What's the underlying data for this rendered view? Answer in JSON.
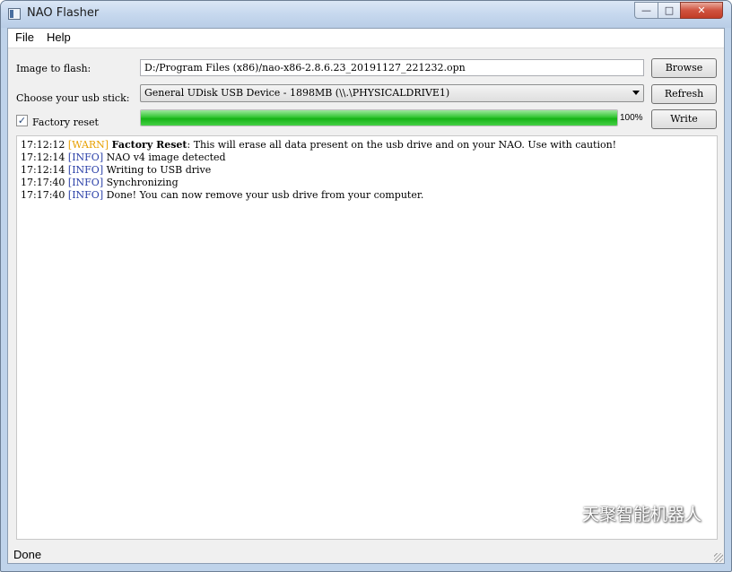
{
  "window": {
    "title": "NAO Flasher"
  },
  "menu": [
    "File",
    "Help"
  ],
  "form": {
    "image_label": "Image to flash:",
    "image_path": "D:/Program Files (x86)/nao-x86-2.8.6.23_20191127_221232.opn",
    "usb_label": "Choose your usb stick:",
    "usb_device": "General UDisk USB Device - 1898MB (\\\\.\\PHYSICALDRIVE1)",
    "factory_reset_label": "Factory reset",
    "factory_reset_checked": true,
    "progress_percent": 100,
    "progress_text": "100%",
    "browse_label": "Browse",
    "refresh_label": "Refresh",
    "write_label": "Write"
  },
  "log": [
    {
      "time": "17:12:12",
      "level": "[WARN]",
      "kind": "warn",
      "bold": "Factory Reset",
      "message": ": This will erase all data present on the usb drive and on your NAO. Use with caution!"
    },
    {
      "time": "17:12:14",
      "level": "[INFO]",
      "kind": "info",
      "bold": "",
      "message": "NAO v4 image detected"
    },
    {
      "time": "17:12:14",
      "level": "[INFO]",
      "kind": "info",
      "bold": "",
      "message": "Writing to USB drive"
    },
    {
      "time": "17:17:40",
      "level": "[INFO]",
      "kind": "info",
      "bold": "",
      "message": "Synchronizing"
    },
    {
      "time": "17:17:40",
      "level": "[INFO]",
      "kind": "info",
      "bold": "",
      "message": "Done! You can now remove your usb drive from your computer."
    }
  ],
  "status": "Done",
  "watermark": "天聚智能机器人",
  "colors": {
    "warn": "#e8a000",
    "info": "#2b40a8",
    "progress": "#16b316"
  }
}
